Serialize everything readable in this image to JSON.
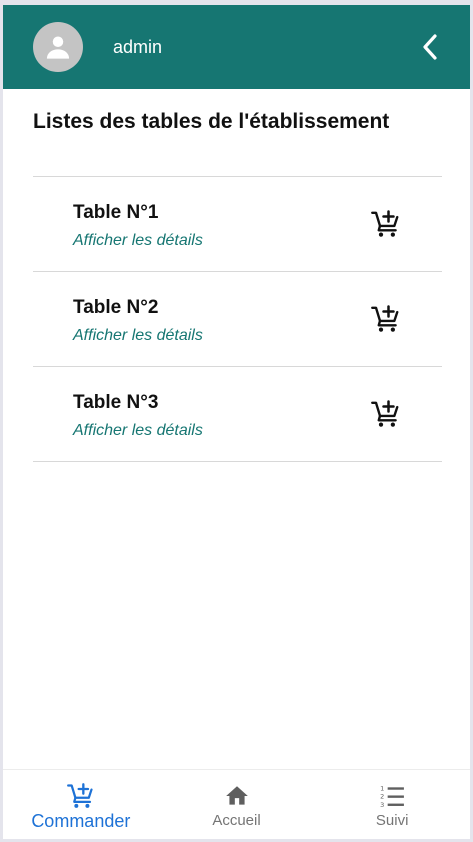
{
  "header": {
    "username": "admin",
    "avatar_icon": "person-icon",
    "back_icon": "chevron-left-icon",
    "bg_color": "#167672"
  },
  "page": {
    "title": "Listes des tables de l'établissement"
  },
  "tables": [
    {
      "name": "Table N°1",
      "subtitle": "Afficher les détails",
      "icon": "cart-plus-icon"
    },
    {
      "name": "Table N°2",
      "subtitle": "Afficher les détails",
      "icon": "cart-plus-icon"
    },
    {
      "name": "Table N°3",
      "subtitle": "Afficher les détails",
      "icon": "cart-plus-icon"
    }
  ],
  "nav": {
    "items": [
      {
        "label": "Commander",
        "icon": "cart-plus-icon",
        "active": true
      },
      {
        "label": "Accueil",
        "icon": "home-icon",
        "active": false
      },
      {
        "label": "Suivi",
        "icon": "numbered-list-icon",
        "active": false
      }
    ],
    "active_color": "#1e72d6",
    "inactive_color": "#757575"
  }
}
